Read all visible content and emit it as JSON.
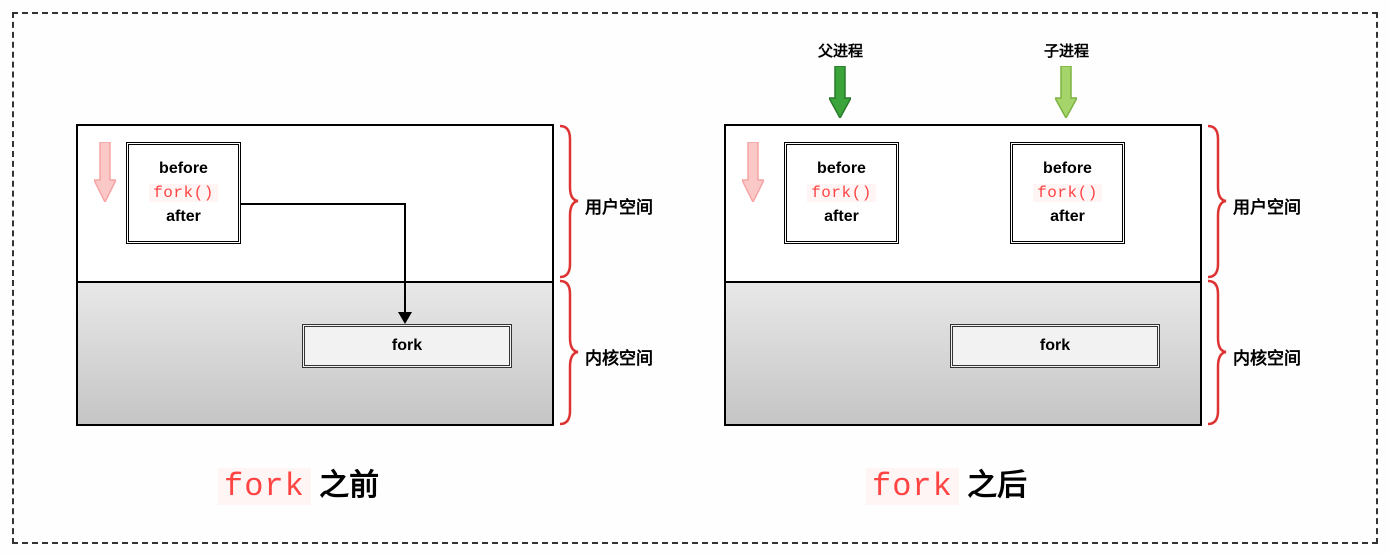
{
  "left": {
    "code": {
      "before": "before",
      "fork": "fork()",
      "after": "after"
    },
    "kernel_box": "fork",
    "user_space_label": "用户空间",
    "kernel_space_label": "内核空间",
    "caption_fork": "fork",
    "caption_suffix": " 之前"
  },
  "right": {
    "parent_label": "父进程",
    "child_label": "子进程",
    "code_parent": {
      "before": "before",
      "fork": "fork()",
      "after": "after"
    },
    "code_child": {
      "before": "before",
      "fork": "fork()",
      "after": "after"
    },
    "kernel_box": "fork",
    "user_space_label": "用户空间",
    "kernel_space_label": "内核空间",
    "caption_fork": "fork",
    "caption_suffix": " 之后"
  },
  "colors": {
    "red": "#ff4444",
    "pink_fill": "#fbc8c8",
    "pink_stroke": "#f7a4a4",
    "green_dark_fill": "#3aa33a",
    "green_dark_stroke": "#2a7a2a",
    "green_light_fill": "#a4d46a",
    "green_light_stroke": "#7cb342"
  }
}
